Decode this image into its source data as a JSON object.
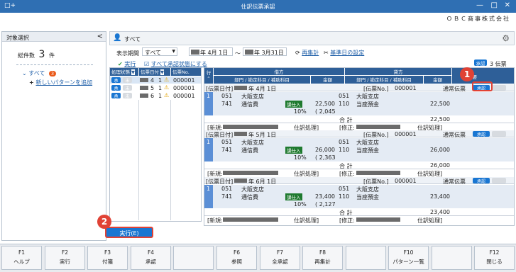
{
  "window": {
    "title": "仕訳伝票承認",
    "app_icon": "□+",
    "minimize": "—",
    "maximize": "□",
    "close": "✕"
  },
  "company": "ＯＢＣ商事株式会社",
  "left_panel": {
    "header": "対象選択",
    "collapse": "<",
    "total_label": "総件数",
    "total_count": "3",
    "total_unit": "件",
    "tree_item": "すべて",
    "tree_badge": "3",
    "add_pattern": "新しいパターンを追加"
  },
  "main": {
    "title": "すべて",
    "period_label": "表示期間",
    "period_select": "すべて",
    "date_from": "年  4月  1日",
    "tilde": "～",
    "date_to": "年  3月31日",
    "recalc": "再集計",
    "base_date": "基準日の設定",
    "approve_tag": "承認",
    "approve_count": "3 伝票",
    "exec_link": "実行",
    "all_approve_link": "すべて承認状態にする"
  },
  "left_grid": {
    "headers": [
      "処理状態",
      "伝票日付",
      "伝票No."
    ],
    "rows": [
      {
        "status": "承",
        "sub": "未",
        "month": "4",
        "day": "1",
        "no": "000001"
      },
      {
        "status": "承",
        "sub": "未",
        "month": "5",
        "day": "1",
        "no": "000001"
      },
      {
        "status": "承",
        "sub": "未",
        "month": "6",
        "day": "1",
        "no": "000001"
      }
    ]
  },
  "right_grid": {
    "col_row": "行",
    "debit": "借方",
    "credit": "貸方",
    "dept": "部門 / 勘定科目 / 補助科目",
    "amount": "金額",
    "summary": "摘要",
    "entries": [
      {
        "date_label": "[伝票日付]",
        "date": "年  4月  1日",
        "no_label": "[伝票No.]",
        "no": "000001",
        "type": "通常伝票",
        "approve": "承認",
        "line": "1",
        "d_dept": "051",
        "d_dept_name": "大阪支店",
        "d_acct": "741",
        "d_acct_name": "通信費",
        "tax_tag": "課仕入",
        "tax_rate": "10%",
        "d_amount": "22,500",
        "tax_amount": "( 2,045",
        "c_dept": "051",
        "c_dept_name": "大阪支店",
        "c_acct": "110",
        "c_acct_name": "当座預金",
        "c_amount": "22,500",
        "total_label": "合  計",
        "total_debit": "22,500",
        "total_credit": "22,500",
        "new_label": "[新規:",
        "process": "仕訳処理]",
        "mod_label": "[修正:",
        "process2": "仕訳処理]"
      },
      {
        "date_label": "[伝票日付]",
        "date": "年  5月  1日",
        "no_label": "[伝票No.]",
        "no": "000001",
        "type": "通常伝票",
        "approve": "承認",
        "line": "1",
        "d_dept": "051",
        "d_dept_name": "大阪支店",
        "d_acct": "741",
        "d_acct_name": "通信費",
        "tax_tag": "課仕入",
        "tax_rate": "10%",
        "d_amount": "26,000",
        "tax_amount": "( 2,363",
        "c_dept": "051",
        "c_dept_name": "大阪支店",
        "c_acct": "110",
        "c_acct_name": "当座預金",
        "c_amount": "26,000",
        "total_label": "合  計",
        "total_debit": "26,000",
        "total_credit": "26,000",
        "new_label": "[新規:",
        "process": "仕訳処理]",
        "mod_label": "[修正:",
        "process2": "仕訳処理]"
      },
      {
        "date_label": "[伝票日付]",
        "date": "年  6月  1日",
        "no_label": "[伝票No.]",
        "no": "000001",
        "type": "通常伝票",
        "approve": "承認",
        "line": "1",
        "d_dept": "051",
        "d_dept_name": "大阪支店",
        "d_acct": "741",
        "d_acct_name": "通信費",
        "tax_tag": "課仕入",
        "tax_rate": "10%",
        "d_amount": "23,400",
        "tax_amount": "( 2,127",
        "c_dept": "051",
        "c_dept_name": "大阪支店",
        "c_acct": "110",
        "c_acct_name": "当座預金",
        "c_amount": "23,400",
        "total_label": "合  計",
        "total_debit": "23,400",
        "total_credit": "23,400",
        "new_label": "[新規:",
        "process": "仕訳処理]",
        "mod_label": "[修正:",
        "process2": "仕訳処理]"
      }
    ]
  },
  "exec_button": "実行(E)",
  "callouts": [
    "1",
    "2"
  ],
  "fkeys": [
    {
      "key": "F1",
      "label": "ヘルプ"
    },
    {
      "key": "F2",
      "label": "実行"
    },
    {
      "key": "F3",
      "label": "付箋"
    },
    {
      "key": "F4",
      "label": "承認"
    },
    {
      "key": "",
      "label": ""
    },
    {
      "key": "F6",
      "label": "参照"
    },
    {
      "key": "F7",
      "label": "全承認"
    },
    {
      "key": "F8",
      "label": "再集計"
    },
    {
      "key": "",
      "label": ""
    },
    {
      "key": "F10",
      "label": "パターン一覧"
    },
    {
      "key": "",
      "label": ""
    },
    {
      "key": "F12",
      "label": "閉じる"
    }
  ]
}
